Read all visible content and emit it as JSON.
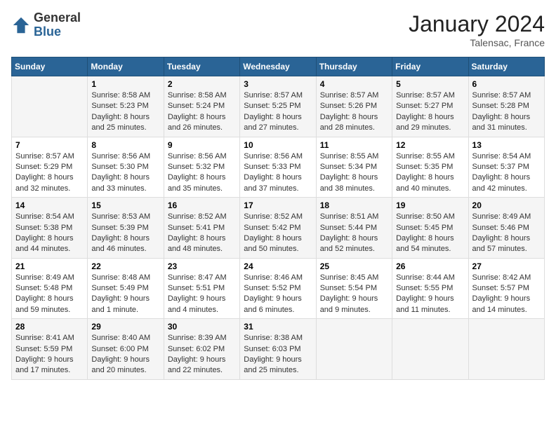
{
  "header": {
    "logo_general": "General",
    "logo_blue": "Blue",
    "month_year": "January 2024",
    "location": "Talensac, France"
  },
  "days_of_week": [
    "Sunday",
    "Monday",
    "Tuesday",
    "Wednesday",
    "Thursday",
    "Friday",
    "Saturday"
  ],
  "weeks": [
    [
      {
        "day": "",
        "sunrise": "",
        "sunset": "",
        "daylight": ""
      },
      {
        "day": "1",
        "sunrise": "Sunrise: 8:58 AM",
        "sunset": "Sunset: 5:23 PM",
        "daylight": "Daylight: 8 hours and 25 minutes."
      },
      {
        "day": "2",
        "sunrise": "Sunrise: 8:58 AM",
        "sunset": "Sunset: 5:24 PM",
        "daylight": "Daylight: 8 hours and 26 minutes."
      },
      {
        "day": "3",
        "sunrise": "Sunrise: 8:57 AM",
        "sunset": "Sunset: 5:25 PM",
        "daylight": "Daylight: 8 hours and 27 minutes."
      },
      {
        "day": "4",
        "sunrise": "Sunrise: 8:57 AM",
        "sunset": "Sunset: 5:26 PM",
        "daylight": "Daylight: 8 hours and 28 minutes."
      },
      {
        "day": "5",
        "sunrise": "Sunrise: 8:57 AM",
        "sunset": "Sunset: 5:27 PM",
        "daylight": "Daylight: 8 hours and 29 minutes."
      },
      {
        "day": "6",
        "sunrise": "Sunrise: 8:57 AM",
        "sunset": "Sunset: 5:28 PM",
        "daylight": "Daylight: 8 hours and 31 minutes."
      }
    ],
    [
      {
        "day": "7",
        "sunrise": "Sunrise: 8:57 AM",
        "sunset": "Sunset: 5:29 PM",
        "daylight": "Daylight: 8 hours and 32 minutes."
      },
      {
        "day": "8",
        "sunrise": "Sunrise: 8:56 AM",
        "sunset": "Sunset: 5:30 PM",
        "daylight": "Daylight: 8 hours and 33 minutes."
      },
      {
        "day": "9",
        "sunrise": "Sunrise: 8:56 AM",
        "sunset": "Sunset: 5:32 PM",
        "daylight": "Daylight: 8 hours and 35 minutes."
      },
      {
        "day": "10",
        "sunrise": "Sunrise: 8:56 AM",
        "sunset": "Sunset: 5:33 PM",
        "daylight": "Daylight: 8 hours and 37 minutes."
      },
      {
        "day": "11",
        "sunrise": "Sunrise: 8:55 AM",
        "sunset": "Sunset: 5:34 PM",
        "daylight": "Daylight: 8 hours and 38 minutes."
      },
      {
        "day": "12",
        "sunrise": "Sunrise: 8:55 AM",
        "sunset": "Sunset: 5:35 PM",
        "daylight": "Daylight: 8 hours and 40 minutes."
      },
      {
        "day": "13",
        "sunrise": "Sunrise: 8:54 AM",
        "sunset": "Sunset: 5:37 PM",
        "daylight": "Daylight: 8 hours and 42 minutes."
      }
    ],
    [
      {
        "day": "14",
        "sunrise": "Sunrise: 8:54 AM",
        "sunset": "Sunset: 5:38 PM",
        "daylight": "Daylight: 8 hours and 44 minutes."
      },
      {
        "day": "15",
        "sunrise": "Sunrise: 8:53 AM",
        "sunset": "Sunset: 5:39 PM",
        "daylight": "Daylight: 8 hours and 46 minutes."
      },
      {
        "day": "16",
        "sunrise": "Sunrise: 8:52 AM",
        "sunset": "Sunset: 5:41 PM",
        "daylight": "Daylight: 8 hours and 48 minutes."
      },
      {
        "day": "17",
        "sunrise": "Sunrise: 8:52 AM",
        "sunset": "Sunset: 5:42 PM",
        "daylight": "Daylight: 8 hours and 50 minutes."
      },
      {
        "day": "18",
        "sunrise": "Sunrise: 8:51 AM",
        "sunset": "Sunset: 5:44 PM",
        "daylight": "Daylight: 8 hours and 52 minutes."
      },
      {
        "day": "19",
        "sunrise": "Sunrise: 8:50 AM",
        "sunset": "Sunset: 5:45 PM",
        "daylight": "Daylight: 8 hours and 54 minutes."
      },
      {
        "day": "20",
        "sunrise": "Sunrise: 8:49 AM",
        "sunset": "Sunset: 5:46 PM",
        "daylight": "Daylight: 8 hours and 57 minutes."
      }
    ],
    [
      {
        "day": "21",
        "sunrise": "Sunrise: 8:49 AM",
        "sunset": "Sunset: 5:48 PM",
        "daylight": "Daylight: 8 hours and 59 minutes."
      },
      {
        "day": "22",
        "sunrise": "Sunrise: 8:48 AM",
        "sunset": "Sunset: 5:49 PM",
        "daylight": "Daylight: 9 hours and 1 minute."
      },
      {
        "day": "23",
        "sunrise": "Sunrise: 8:47 AM",
        "sunset": "Sunset: 5:51 PM",
        "daylight": "Daylight: 9 hours and 4 minutes."
      },
      {
        "day": "24",
        "sunrise": "Sunrise: 8:46 AM",
        "sunset": "Sunset: 5:52 PM",
        "daylight": "Daylight: 9 hours and 6 minutes."
      },
      {
        "day": "25",
        "sunrise": "Sunrise: 8:45 AM",
        "sunset": "Sunset: 5:54 PM",
        "daylight": "Daylight: 9 hours and 9 minutes."
      },
      {
        "day": "26",
        "sunrise": "Sunrise: 8:44 AM",
        "sunset": "Sunset: 5:55 PM",
        "daylight": "Daylight: 9 hours and 11 minutes."
      },
      {
        "day": "27",
        "sunrise": "Sunrise: 8:42 AM",
        "sunset": "Sunset: 5:57 PM",
        "daylight": "Daylight: 9 hours and 14 minutes."
      }
    ],
    [
      {
        "day": "28",
        "sunrise": "Sunrise: 8:41 AM",
        "sunset": "Sunset: 5:59 PM",
        "daylight": "Daylight: 9 hours and 17 minutes."
      },
      {
        "day": "29",
        "sunrise": "Sunrise: 8:40 AM",
        "sunset": "Sunset: 6:00 PM",
        "daylight": "Daylight: 9 hours and 20 minutes."
      },
      {
        "day": "30",
        "sunrise": "Sunrise: 8:39 AM",
        "sunset": "Sunset: 6:02 PM",
        "daylight": "Daylight: 9 hours and 22 minutes."
      },
      {
        "day": "31",
        "sunrise": "Sunrise: 8:38 AM",
        "sunset": "Sunset: 6:03 PM",
        "daylight": "Daylight: 9 hours and 25 minutes."
      },
      {
        "day": "",
        "sunrise": "",
        "sunset": "",
        "daylight": ""
      },
      {
        "day": "",
        "sunrise": "",
        "sunset": "",
        "daylight": ""
      },
      {
        "day": "",
        "sunrise": "",
        "sunset": "",
        "daylight": ""
      }
    ]
  ]
}
